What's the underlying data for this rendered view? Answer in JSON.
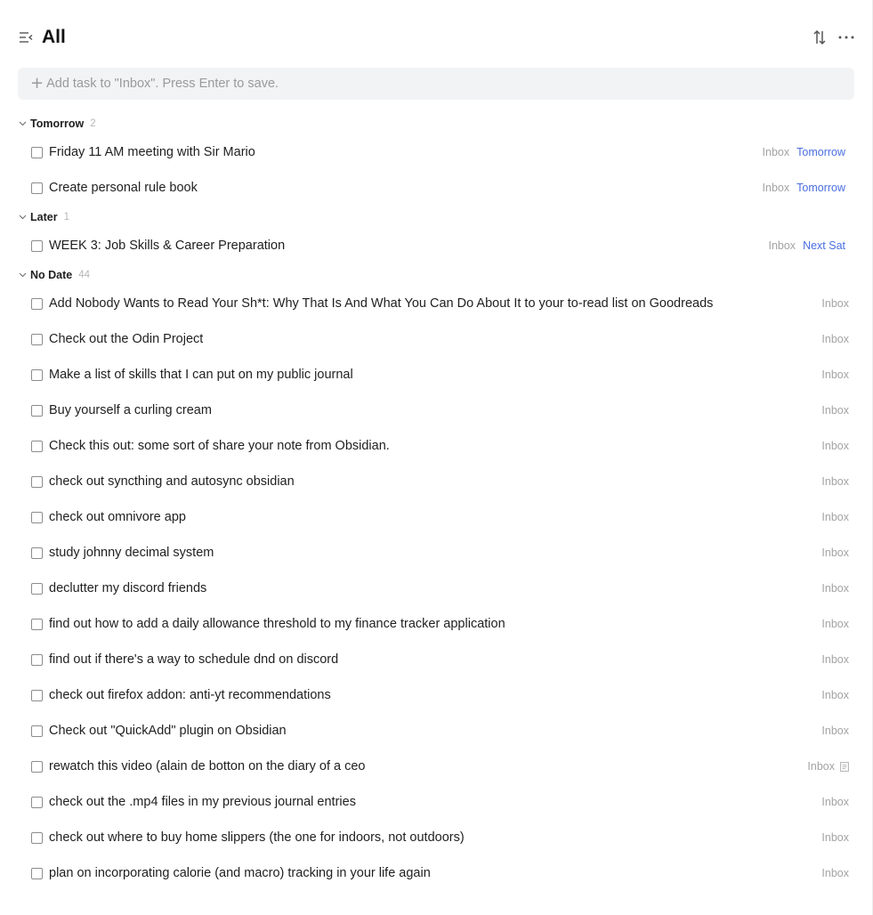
{
  "header": {
    "title": "All"
  },
  "add_task": {
    "placeholder": "Add task to \"Inbox\". Press Enter to save."
  },
  "colors": {
    "accent_date": "#4a6ee0",
    "muted": "#a3a3a3",
    "input_bg": "#f2f3f5"
  },
  "icons": {
    "menu": "collapse-sidebar-icon",
    "sort": "sort-icon",
    "more": "more-icon",
    "section": "chevron-down-icon",
    "checkbox": "checkbox-icon",
    "note": "note-icon",
    "add": "plus-icon"
  },
  "sections": [
    {
      "title": "Tomorrow",
      "count": "2",
      "tasks": [
        {
          "title": "Friday 11 AM meeting with Sir Mario",
          "list": "Inbox",
          "due": "Tomorrow"
        },
        {
          "title": "Create personal rule book",
          "list": "Inbox",
          "due": "Tomorrow"
        }
      ]
    },
    {
      "title": "Later",
      "count": "1",
      "tasks": [
        {
          "title": "WEEK 3: Job Skills & Career Preparation",
          "list": "Inbox",
          "due": "Next Sat"
        }
      ]
    },
    {
      "title": "No Date",
      "count": "44",
      "tasks": [
        {
          "title": "Add Nobody Wants to Read Your Sh*t: Why That Is And What You Can Do About It to your to-read list on Goodreads",
          "list": "Inbox"
        },
        {
          "title": "Check out the Odin Project",
          "list": "Inbox"
        },
        {
          "title": "Make a list of skills that I can put on my public journal",
          "list": "Inbox"
        },
        {
          "title": "Buy yourself a curling cream",
          "list": "Inbox"
        },
        {
          "title": "Check this out: some sort of share your note from Obsidian.",
          "list": "Inbox"
        },
        {
          "title": "check out syncthing and autosync obsidian",
          "list": "Inbox"
        },
        {
          "title": "check out omnivore app",
          "list": "Inbox"
        },
        {
          "title": "study johnny decimal system",
          "list": "Inbox"
        },
        {
          "title": "declutter my discord friends",
          "list": "Inbox"
        },
        {
          "title": "find out how to add a daily allowance threshold to my finance tracker application",
          "list": "Inbox"
        },
        {
          "title": "find out if there's a way to schedule dnd on discord",
          "list": "Inbox"
        },
        {
          "title": "check out firefox addon: anti-yt recommendations",
          "list": "Inbox"
        },
        {
          "title": "Check out \"QuickAdd\" plugin on Obsidian",
          "list": "Inbox"
        },
        {
          "title": "rewatch this video (alain de botton on the diary of a ceo",
          "list": "Inbox",
          "has_note": true
        },
        {
          "title": "check out the .mp4 files in my previous journal entries",
          "list": "Inbox"
        },
        {
          "title": "check out where to buy home slippers (the one for indoors, not outdoors)",
          "list": "Inbox"
        },
        {
          "title": "plan on incorporating calorie (and macro) tracking in your life again",
          "list": "Inbox"
        }
      ]
    }
  ]
}
